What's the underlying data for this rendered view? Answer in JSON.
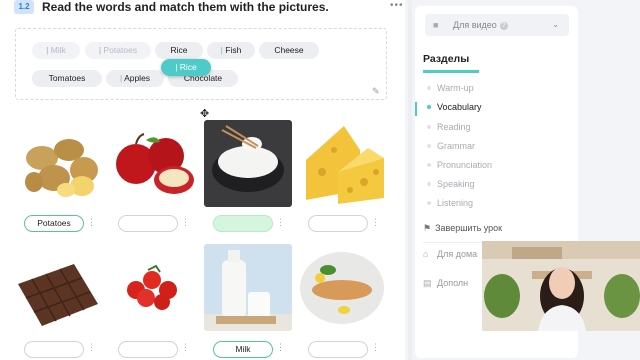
{
  "task": {
    "number": "1.2",
    "title": "Read the words and match them with the pictures.",
    "menu_glyph": "•••"
  },
  "word_bank": {
    "chips": [
      {
        "label": "Milk",
        "state": "used"
      },
      {
        "label": "Potatoes",
        "state": "used"
      },
      {
        "label": "Rice",
        "state": "active"
      },
      {
        "label": "Fish",
        "state": "active"
      },
      {
        "label": "Cheese",
        "state": "active"
      },
      {
        "label": "Tomatoes",
        "state": "active"
      },
      {
        "label": "Apples",
        "state": "active"
      },
      {
        "label": "Chocolate",
        "state": "active"
      }
    ],
    "dragging_chip": "Rice"
  },
  "cards": [
    {
      "image": "potatoes",
      "answer": "Potatoes",
      "state": "correct"
    },
    {
      "image": "apples",
      "answer": "",
      "state": "empty"
    },
    {
      "image": "rice",
      "answer": "",
      "state": "highlight"
    },
    {
      "image": "cheese",
      "answer": "",
      "state": "empty"
    },
    {
      "image": "chocolate",
      "answer": "",
      "state": "empty"
    },
    {
      "image": "tomatoes",
      "answer": "",
      "state": "empty"
    },
    {
      "image": "milk",
      "answer": "Milk",
      "state": "correct"
    },
    {
      "image": "fish",
      "answer": "",
      "state": "empty"
    }
  ],
  "sidebar": {
    "video_select": {
      "label": "Для видео",
      "help": "?",
      "icon": "camera-icon"
    },
    "sections_title": "Разделы",
    "sections": [
      {
        "label": "Warm-up",
        "current": false
      },
      {
        "label": "Vocabulary",
        "current": true
      },
      {
        "label": "Reading",
        "current": false
      },
      {
        "label": "Grammar",
        "current": false
      },
      {
        "label": "Pronunciation",
        "current": false
      },
      {
        "label": "Speaking",
        "current": false
      },
      {
        "label": "Listening",
        "current": false
      }
    ],
    "finish_label": "Завершить урок",
    "links": [
      {
        "label": "Для дома",
        "icon": "home-icon"
      },
      {
        "label": "Дополн",
        "icon": "document-icon"
      }
    ]
  },
  "colors": {
    "accent": "#4ecbc9",
    "correct": "#56c596",
    "highlight": "#d6f5de",
    "badge_bg": "#cfe4fb",
    "badge_text": "#2f7fd0"
  }
}
